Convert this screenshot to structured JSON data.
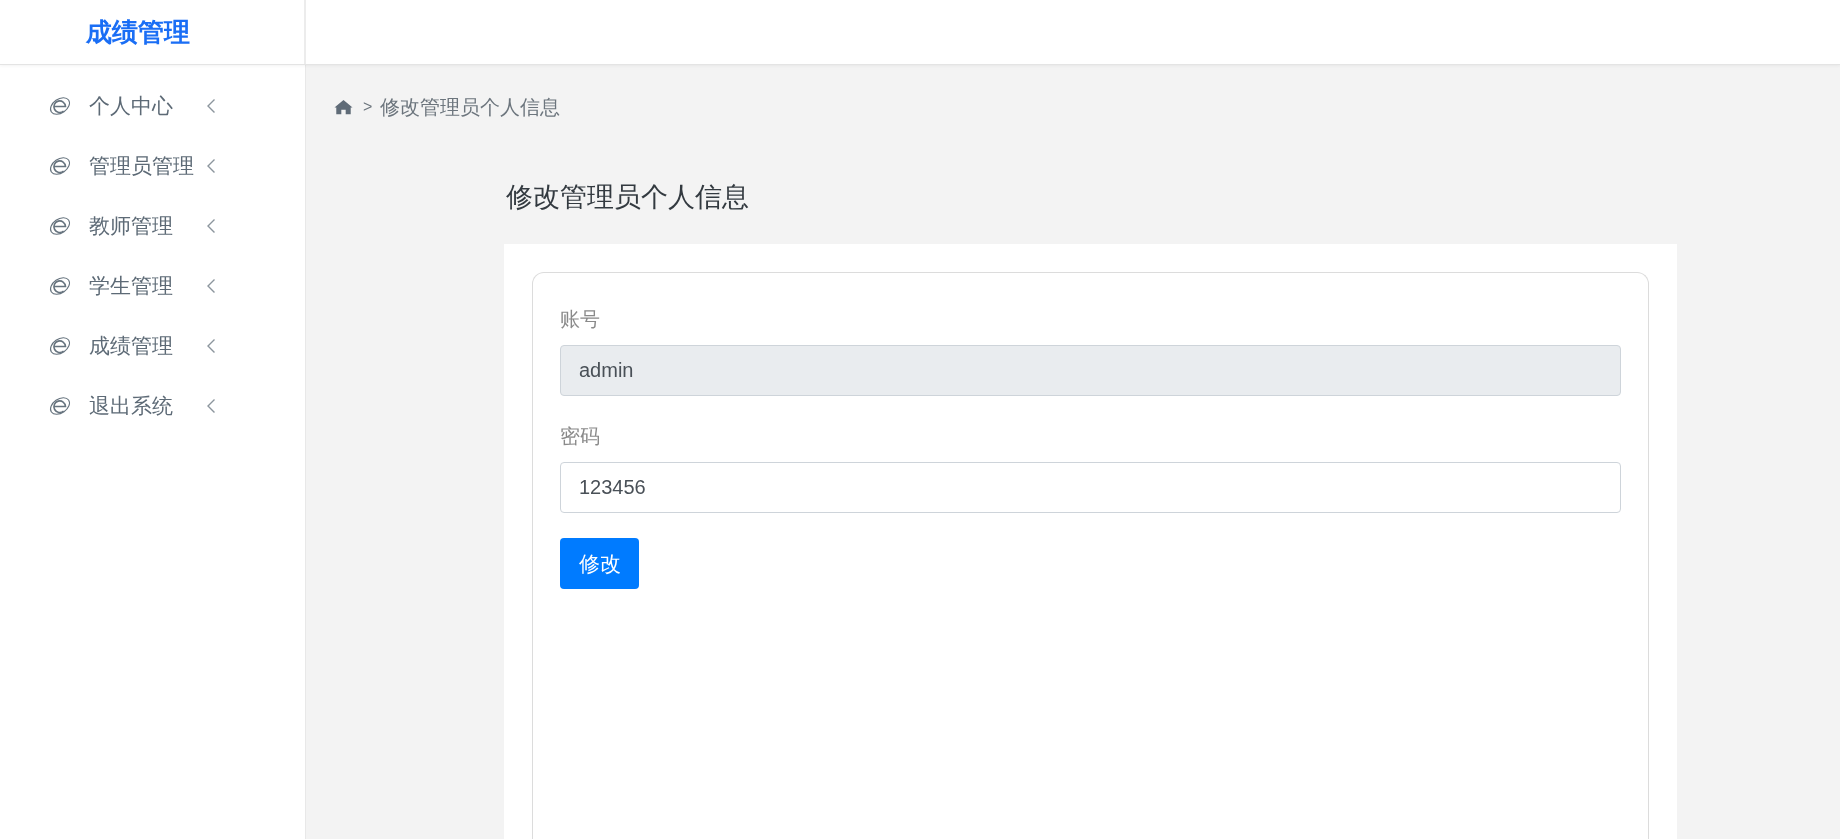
{
  "header": {
    "logo": "成绩管理"
  },
  "sidebar": {
    "items": [
      {
        "label": "个人中心",
        "expanded": false
      },
      {
        "label": "管理员管理",
        "expanded": false
      },
      {
        "label": "教师管理",
        "expanded": false
      },
      {
        "label": "学生管理",
        "expanded": false
      },
      {
        "label": "成绩管理",
        "expanded": false
      },
      {
        "label": "退出系统",
        "expanded": false
      }
    ]
  },
  "breadcrumb": {
    "separator": ">",
    "current": "修改管理员个人信息"
  },
  "page_title": "修改管理员个人信息",
  "form": {
    "fields": [
      {
        "label": "账号",
        "value": "admin",
        "disabled": true
      },
      {
        "label": "密码",
        "value": "123456",
        "disabled": false
      }
    ],
    "submit": "修改"
  }
}
